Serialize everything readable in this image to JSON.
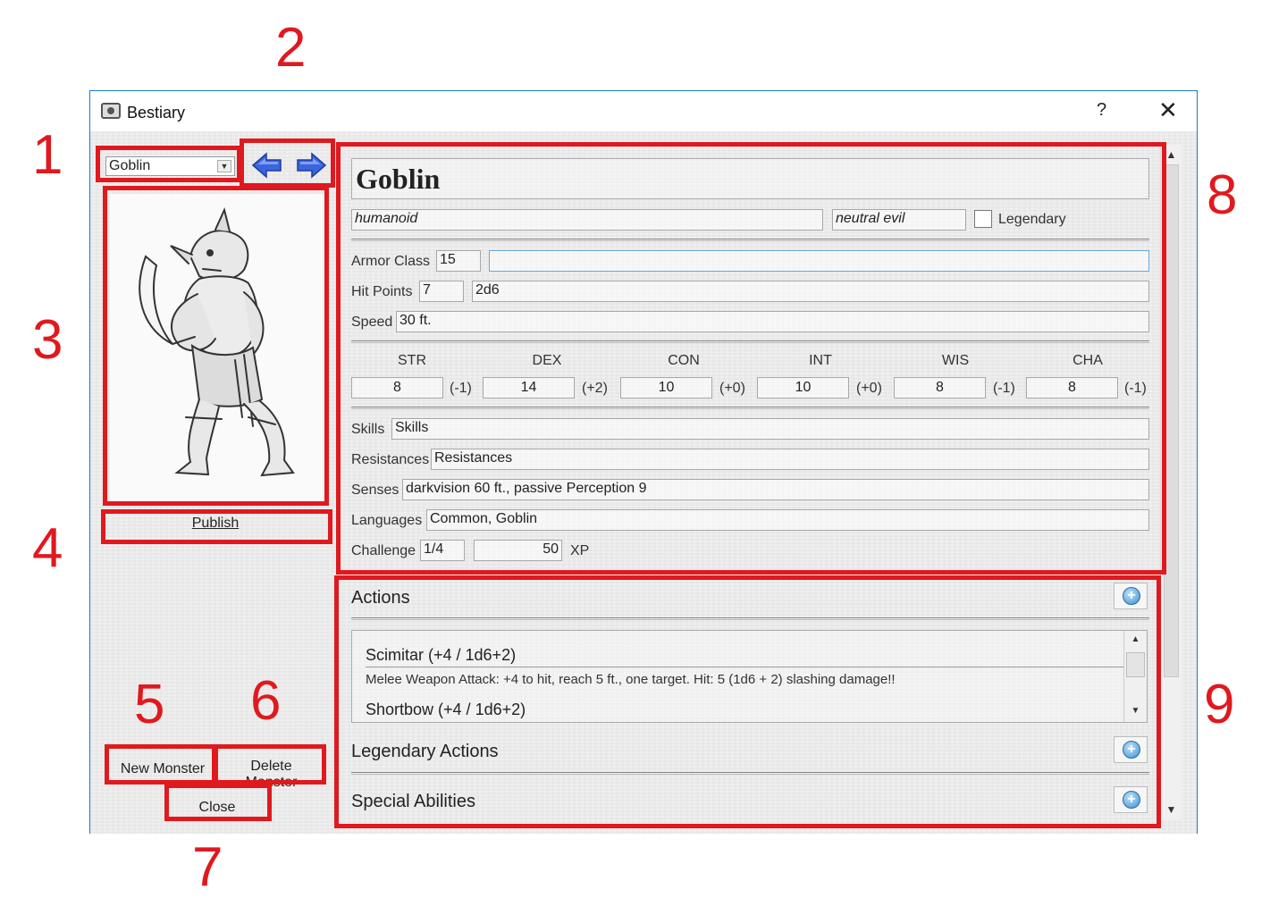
{
  "callouts": [
    "1",
    "2",
    "3",
    "4",
    "5",
    "6",
    "7",
    "8",
    "9"
  ],
  "window": {
    "title": "Bestiary",
    "help": "?",
    "close": "✕"
  },
  "monster_select": {
    "value": "Goblin"
  },
  "buttons": {
    "publish": "Publish",
    "new_monster": "New Monster",
    "delete_monster": "Delete Monster",
    "close": "Close"
  },
  "statblock": {
    "name": "Goblin",
    "type": "humanoid",
    "alignment": "neutral evil",
    "legendary_label": "Legendary",
    "legendary_checked": false,
    "armor_class": {
      "label": "Armor Class",
      "value": "15",
      "notes": ""
    },
    "hit_points": {
      "label": "Hit Points",
      "value": "7",
      "dice": "2d6"
    },
    "speed": {
      "label": "Speed",
      "value": "30 ft."
    },
    "abilities": [
      {
        "name": "STR",
        "score": "8",
        "mod": "(-1)"
      },
      {
        "name": "DEX",
        "score": "14",
        "mod": "(+2)"
      },
      {
        "name": "CON",
        "score": "10",
        "mod": "(+0)"
      },
      {
        "name": "INT",
        "score": "10",
        "mod": "(+0)"
      },
      {
        "name": "WIS",
        "score": "8",
        "mod": "(-1)"
      },
      {
        "name": "CHA",
        "score": "8",
        "mod": "(-1)"
      }
    ],
    "skills": {
      "label": "Skills",
      "value": "Skills"
    },
    "resistances": {
      "label": "Resistances",
      "value": "Resistances"
    },
    "senses": {
      "label": "Senses",
      "value": "darkvision 60 ft., passive Perception 9"
    },
    "languages": {
      "label": "Languages",
      "value": "Common, Goblin"
    },
    "challenge": {
      "label": "Challenge",
      "value": "1/4",
      "xp": "50",
      "xp_label": "XP"
    }
  },
  "sections": {
    "actions": {
      "title": "Actions",
      "items": [
        {
          "name": "Scimitar (+4 / 1d6+2)",
          "desc": "Melee Weapon Attack: +4 to hit, reach 5 ft., one target. Hit: 5 (1d6 + 2) slashing damage!!"
        },
        {
          "name": "Shortbow (+4 / 1d6+2)"
        }
      ]
    },
    "legendary": {
      "title": "Legendary Actions"
    },
    "special": {
      "title": "Special Abilities"
    }
  },
  "colors": {
    "annotation": "#e0191e",
    "window_border": "#1a7ad1",
    "nav_arrow": "#3a64e0"
  },
  "icons": [
    "app-icon",
    "help-icon",
    "close-icon",
    "dropdown-arrow-icon",
    "prev-arrow-icon",
    "next-arrow-icon",
    "add-icon",
    "checkbox-icon"
  ]
}
